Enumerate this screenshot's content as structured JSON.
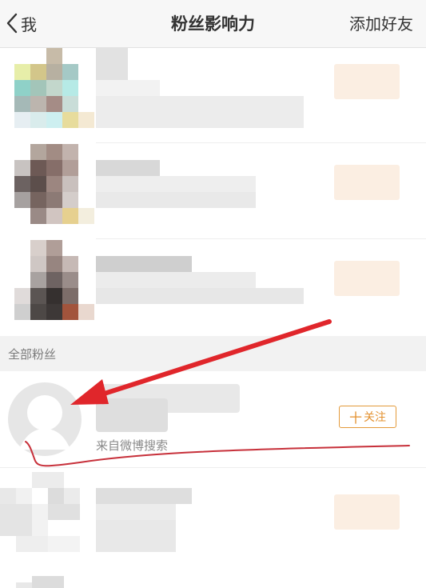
{
  "header": {
    "back_label": "我",
    "title": "粉丝影响力",
    "add_friend_label": "添加好友"
  },
  "section": {
    "title": "全部粉丝"
  },
  "fan_item": {
    "source_text": "来自微博搜索",
    "follow_plus": "十",
    "follow_label": "关注"
  },
  "colors": {
    "accent_orange": "#e3902e",
    "annotation_red": "#e0262b"
  }
}
